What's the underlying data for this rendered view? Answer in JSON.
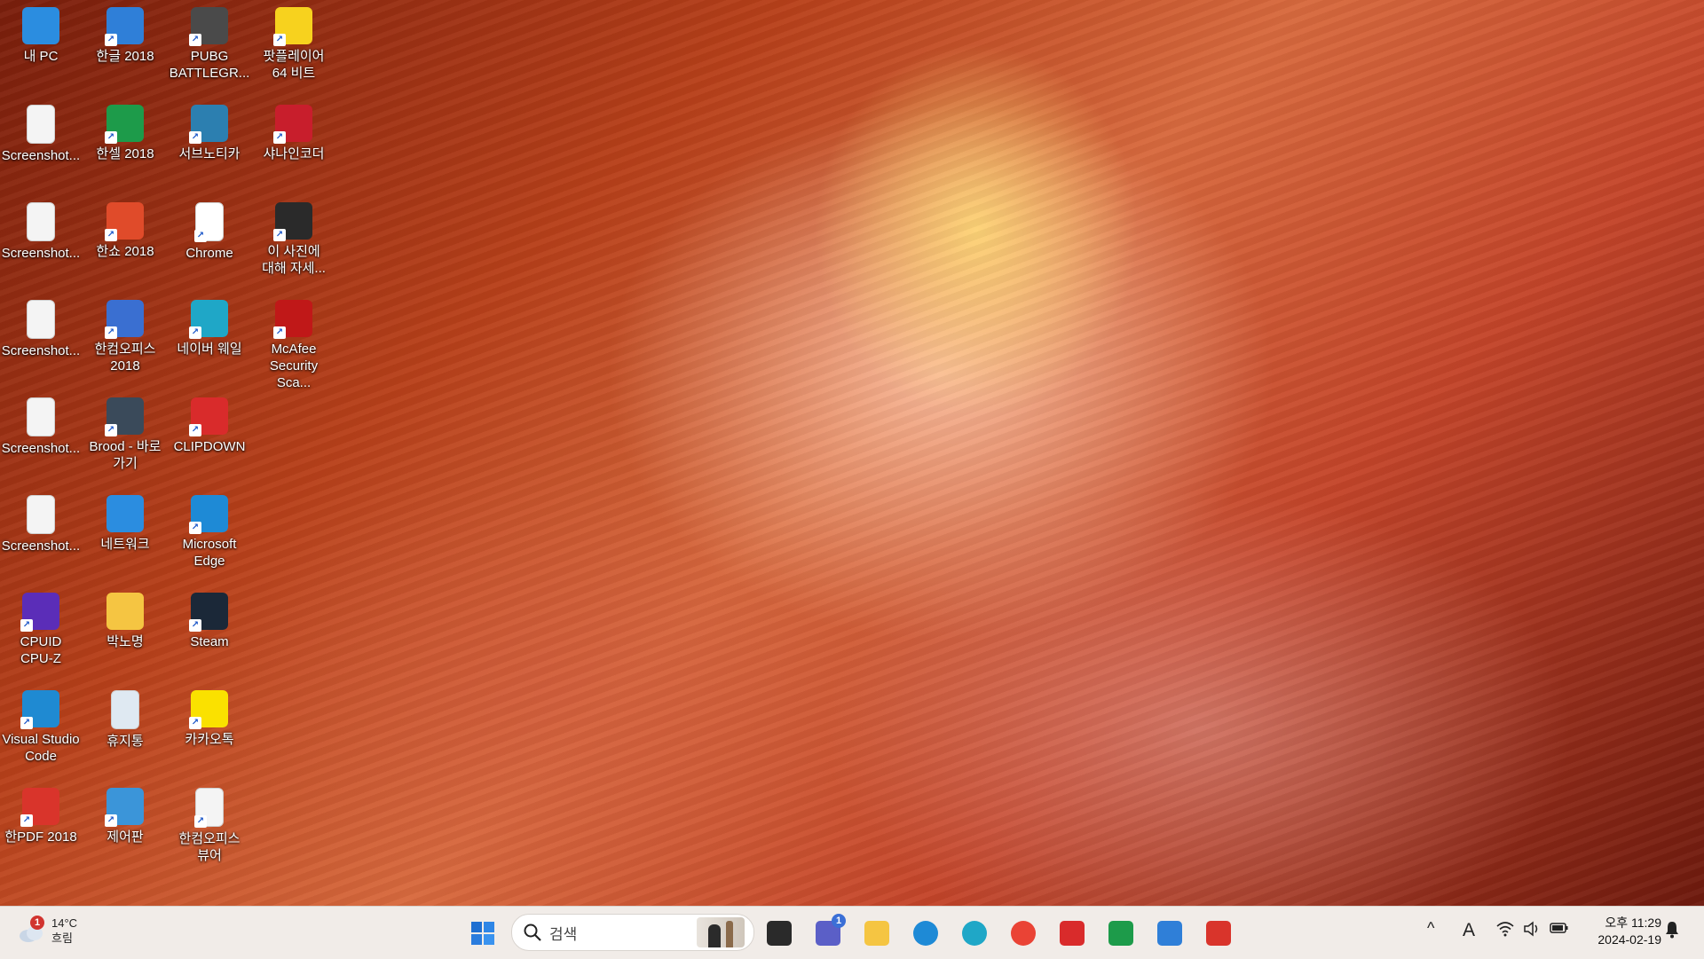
{
  "desktop_icons": [
    {
      "label": "내 PC",
      "icon": "monitor-icon",
      "color": "#2b8de0"
    },
    {
      "label": "Screenshot...",
      "icon": "image-file-icon",
      "color": "#f4f4f4"
    },
    {
      "label": "Screenshot...",
      "icon": "image-file-icon",
      "color": "#f4f4f4"
    },
    {
      "label": "Screenshot...",
      "icon": "image-file-icon",
      "color": "#f4f4f4"
    },
    {
      "label": "Screenshot...",
      "icon": "image-file-icon",
      "color": "#f4f4f4"
    },
    {
      "label": "Screenshot...",
      "icon": "image-file-icon",
      "color": "#f4f4f4"
    },
    {
      "label": "CPUID\nCPU-Z",
      "icon": "cpuz-icon",
      "color": "#5b2db8"
    },
    {
      "label": "Visual Studio\nCode",
      "icon": "vscode-icon",
      "color": "#1f8ad2"
    },
    {
      "label": "한PDF 2018",
      "icon": "hanpdf-icon",
      "color": "#d9342b"
    },
    {
      "label": "한글 2018",
      "icon": "hangul-icon",
      "color": "#2f7fd8"
    },
    {
      "label": "한셀 2018",
      "icon": "hancell-icon",
      "color": "#1d9b4a"
    },
    {
      "label": "한쇼 2018",
      "icon": "hanshow-icon",
      "color": "#e04b2a"
    },
    {
      "label": "한컴오피스\n2018",
      "icon": "hancom-office-icon",
      "color": "#3a6fd1"
    },
    {
      "label": "Brood - 바로\n가기",
      "icon": "brood-icon",
      "color": "#3a4a5a"
    },
    {
      "label": "네트워크",
      "icon": "network-icon",
      "color": "#2b8de0"
    },
    {
      "label": "박노명",
      "icon": "folder-icon",
      "color": "#f5c542"
    },
    {
      "label": "휴지통",
      "icon": "recycle-bin-icon",
      "color": "#dfe9f2"
    },
    {
      "label": "제어판",
      "icon": "control-panel-icon",
      "color": "#3b95d9"
    },
    {
      "label": "PUBG\nBATTLEGR...",
      "icon": "pubg-icon",
      "color": "#4a4a4a"
    },
    {
      "label": "서브노티카",
      "icon": "subnautica-icon",
      "color": "#2c7fb0"
    },
    {
      "label": "Chrome",
      "icon": "chrome-icon",
      "color": "#ffffff"
    },
    {
      "label": "네이버 웨일",
      "icon": "whale-icon",
      "color": "#1fa7c7"
    },
    {
      "label": "CLIPDOWN",
      "icon": "clipdown-icon",
      "color": "#d92b2b"
    },
    {
      "label": "Microsoft\nEdge",
      "icon": "edge-icon",
      "color": "#1e8ad6"
    },
    {
      "label": "Steam",
      "icon": "steam-icon",
      "color": "#1b2838"
    },
    {
      "label": "카카오톡",
      "icon": "kakaotalk-icon",
      "color": "#fae100"
    },
    {
      "label": "한컴오피스\n뷰어",
      "icon": "hancom-viewer-icon",
      "color": "#f4f4f4"
    },
    {
      "label": "팟플레이어\n64 비트",
      "icon": "potplayer-icon",
      "color": "#f7d21e"
    },
    {
      "label": "샤나인코더",
      "icon": "shana-encoder-icon",
      "color": "#c81e2c"
    },
    {
      "label": "이 사진에\n대해 자세...",
      "icon": "spotlight-info-icon",
      "color": "#2a2a2a"
    },
    {
      "label": "McAfee\nSecurity Sca...",
      "icon": "mcafee-icon",
      "color": "#c01818"
    }
  ],
  "taskbar": {
    "weather": {
      "badge": "1",
      "temp": "14°C",
      "condition": "흐림",
      "icon": "cloud-icon"
    },
    "start_icon": "windows-start-icon",
    "search": {
      "placeholder": "검색",
      "icon": "search-icon"
    },
    "apps": [
      {
        "name": "task-view",
        "icon": "task-view-icon",
        "color": "#2a2a2a"
      },
      {
        "name": "teams-chat",
        "icon": "chat-icon",
        "color": "#5b5fc7",
        "badge": "1"
      },
      {
        "name": "file-explorer",
        "icon": "folder-icon",
        "color": "#f5c542"
      },
      {
        "name": "edge",
        "icon": "edge-icon",
        "color": "#1e8ad6"
      },
      {
        "name": "naver-whale",
        "icon": "whale-icon",
        "color": "#1fa7c7"
      },
      {
        "name": "chrome",
        "icon": "chrome-icon",
        "color": "#ea4335"
      },
      {
        "name": "clipdown",
        "icon": "clipdown-icon",
        "color": "#d92b2b"
      },
      {
        "name": "hancell",
        "icon": "hancell-icon",
        "color": "#1d9b4a"
      },
      {
        "name": "hangul",
        "icon": "hangul-icon",
        "color": "#2f7fd8"
      },
      {
        "name": "hanpdf",
        "icon": "hanpdf-icon",
        "color": "#d9342b"
      }
    ],
    "tray": {
      "chevron": "^",
      "ime": "A",
      "clock_time": "오후 11:29",
      "clock_date": "2024-02-19"
    }
  }
}
